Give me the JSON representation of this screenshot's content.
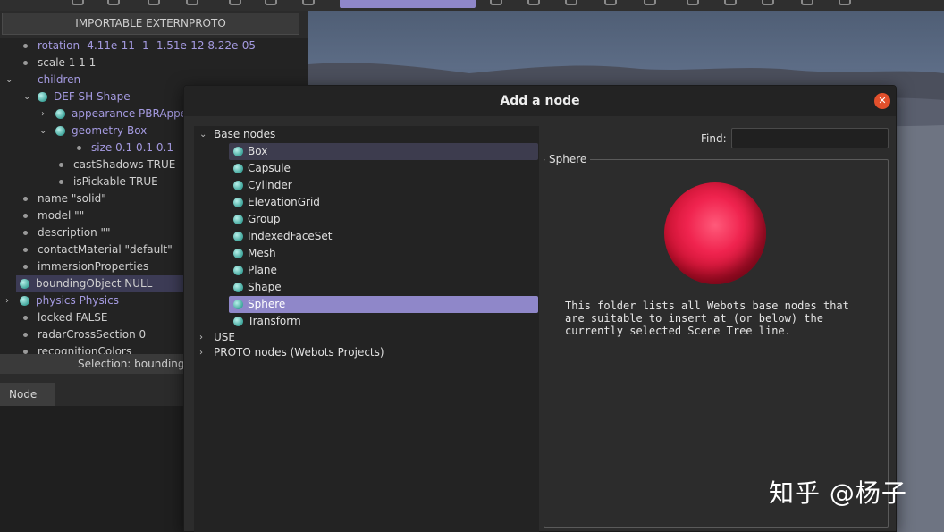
{
  "toolbar": {
    "highlight_color": "#8f87c9"
  },
  "scene_tree": {
    "header_button": "IMPORTABLE EXTERNPROTO",
    "rows": [
      {
        "text": "rotation -4.11e-11 -1 -1.51e-12 8.22e-05",
        "style": "purple"
      },
      {
        "text": "scale 1 1 1",
        "style": "plain"
      },
      {
        "text": "children",
        "style": "purple"
      },
      {
        "text": "DEF SH Shape",
        "style": "purple"
      },
      {
        "text": "appearance PBRAppe",
        "style": "purple"
      },
      {
        "text": "geometry Box",
        "style": "purple"
      },
      {
        "text": "size 0.1 0.1 0.1",
        "style": "purple"
      },
      {
        "text": "castShadows TRUE",
        "style": "plain"
      },
      {
        "text": "isPickable TRUE",
        "style": "plain"
      },
      {
        "text": "name \"solid\"",
        "style": "plain"
      },
      {
        "text": "model \"\"",
        "style": "plain"
      },
      {
        "text": "description \"\"",
        "style": "plain"
      },
      {
        "text": "contactMaterial \"default\"",
        "style": "plain"
      },
      {
        "text": "immersionProperties",
        "style": "plain"
      },
      {
        "text": "boundingObject NULL",
        "style": "plain"
      },
      {
        "text": "physics Physics",
        "style": "purple"
      },
      {
        "text": "locked FALSE",
        "style": "plain"
      },
      {
        "text": "radarCrossSection 0",
        "style": "plain"
      },
      {
        "text": "recognitionColors",
        "style": "plain"
      }
    ],
    "selection_text": "Selection: boundingO",
    "tab_label": "Node"
  },
  "dialog": {
    "title": "Add a node",
    "close_icon": "close-icon",
    "base_nodes_label": "Base nodes",
    "base_nodes": [
      "Box",
      "Capsule",
      "Cylinder",
      "ElevationGrid",
      "Group",
      "IndexedFaceSet",
      "Mesh",
      "Plane",
      "Shape",
      "Sphere",
      "Transform"
    ],
    "selected_node": "Sphere",
    "use_label": "USE",
    "proto_label": "PROTO nodes (Webots Projects)",
    "find_label": "Find:",
    "find_value": "",
    "preview_title": "Sphere",
    "preview_description": "This folder lists all Webots base nodes that\nare suitable to insert at (or below) the\ncurrently selected Scene Tree line.",
    "sphere_color": "#f0244f"
  },
  "watermark": "知乎 @杨子"
}
